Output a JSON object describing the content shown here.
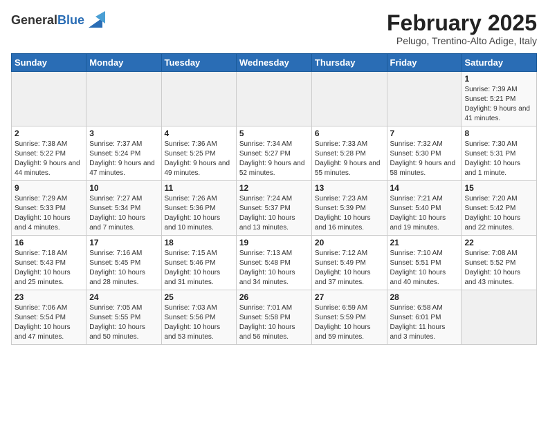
{
  "header": {
    "logo_general": "General",
    "logo_blue": "Blue",
    "month_title": "February 2025",
    "subtitle": "Pelugo, Trentino-Alto Adige, Italy"
  },
  "days_of_week": [
    "Sunday",
    "Monday",
    "Tuesday",
    "Wednesday",
    "Thursday",
    "Friday",
    "Saturday"
  ],
  "weeks": [
    [
      {
        "day": "",
        "info": ""
      },
      {
        "day": "",
        "info": ""
      },
      {
        "day": "",
        "info": ""
      },
      {
        "day": "",
        "info": ""
      },
      {
        "day": "",
        "info": ""
      },
      {
        "day": "",
        "info": ""
      },
      {
        "day": "1",
        "info": "Sunrise: 7:39 AM\nSunset: 5:21 PM\nDaylight: 9 hours and 41 minutes."
      }
    ],
    [
      {
        "day": "2",
        "info": "Sunrise: 7:38 AM\nSunset: 5:22 PM\nDaylight: 9 hours and 44 minutes."
      },
      {
        "day": "3",
        "info": "Sunrise: 7:37 AM\nSunset: 5:24 PM\nDaylight: 9 hours and 47 minutes."
      },
      {
        "day": "4",
        "info": "Sunrise: 7:36 AM\nSunset: 5:25 PM\nDaylight: 9 hours and 49 minutes."
      },
      {
        "day": "5",
        "info": "Sunrise: 7:34 AM\nSunset: 5:27 PM\nDaylight: 9 hours and 52 minutes."
      },
      {
        "day": "6",
        "info": "Sunrise: 7:33 AM\nSunset: 5:28 PM\nDaylight: 9 hours and 55 minutes."
      },
      {
        "day": "7",
        "info": "Sunrise: 7:32 AM\nSunset: 5:30 PM\nDaylight: 9 hours and 58 minutes."
      },
      {
        "day": "8",
        "info": "Sunrise: 7:30 AM\nSunset: 5:31 PM\nDaylight: 10 hours and 1 minute."
      }
    ],
    [
      {
        "day": "9",
        "info": "Sunrise: 7:29 AM\nSunset: 5:33 PM\nDaylight: 10 hours and 4 minutes."
      },
      {
        "day": "10",
        "info": "Sunrise: 7:27 AM\nSunset: 5:34 PM\nDaylight: 10 hours and 7 minutes."
      },
      {
        "day": "11",
        "info": "Sunrise: 7:26 AM\nSunset: 5:36 PM\nDaylight: 10 hours and 10 minutes."
      },
      {
        "day": "12",
        "info": "Sunrise: 7:24 AM\nSunset: 5:37 PM\nDaylight: 10 hours and 13 minutes."
      },
      {
        "day": "13",
        "info": "Sunrise: 7:23 AM\nSunset: 5:39 PM\nDaylight: 10 hours and 16 minutes."
      },
      {
        "day": "14",
        "info": "Sunrise: 7:21 AM\nSunset: 5:40 PM\nDaylight: 10 hours and 19 minutes."
      },
      {
        "day": "15",
        "info": "Sunrise: 7:20 AM\nSunset: 5:42 PM\nDaylight: 10 hours and 22 minutes."
      }
    ],
    [
      {
        "day": "16",
        "info": "Sunrise: 7:18 AM\nSunset: 5:43 PM\nDaylight: 10 hours and 25 minutes."
      },
      {
        "day": "17",
        "info": "Sunrise: 7:16 AM\nSunset: 5:45 PM\nDaylight: 10 hours and 28 minutes."
      },
      {
        "day": "18",
        "info": "Sunrise: 7:15 AM\nSunset: 5:46 PM\nDaylight: 10 hours and 31 minutes."
      },
      {
        "day": "19",
        "info": "Sunrise: 7:13 AM\nSunset: 5:48 PM\nDaylight: 10 hours and 34 minutes."
      },
      {
        "day": "20",
        "info": "Sunrise: 7:12 AM\nSunset: 5:49 PM\nDaylight: 10 hours and 37 minutes."
      },
      {
        "day": "21",
        "info": "Sunrise: 7:10 AM\nSunset: 5:51 PM\nDaylight: 10 hours and 40 minutes."
      },
      {
        "day": "22",
        "info": "Sunrise: 7:08 AM\nSunset: 5:52 PM\nDaylight: 10 hours and 43 minutes."
      }
    ],
    [
      {
        "day": "23",
        "info": "Sunrise: 7:06 AM\nSunset: 5:54 PM\nDaylight: 10 hours and 47 minutes."
      },
      {
        "day": "24",
        "info": "Sunrise: 7:05 AM\nSunset: 5:55 PM\nDaylight: 10 hours and 50 minutes."
      },
      {
        "day": "25",
        "info": "Sunrise: 7:03 AM\nSunset: 5:56 PM\nDaylight: 10 hours and 53 minutes."
      },
      {
        "day": "26",
        "info": "Sunrise: 7:01 AM\nSunset: 5:58 PM\nDaylight: 10 hours and 56 minutes."
      },
      {
        "day": "27",
        "info": "Sunrise: 6:59 AM\nSunset: 5:59 PM\nDaylight: 10 hours and 59 minutes."
      },
      {
        "day": "28",
        "info": "Sunrise: 6:58 AM\nSunset: 6:01 PM\nDaylight: 11 hours and 3 minutes."
      },
      {
        "day": "",
        "info": ""
      }
    ]
  ]
}
